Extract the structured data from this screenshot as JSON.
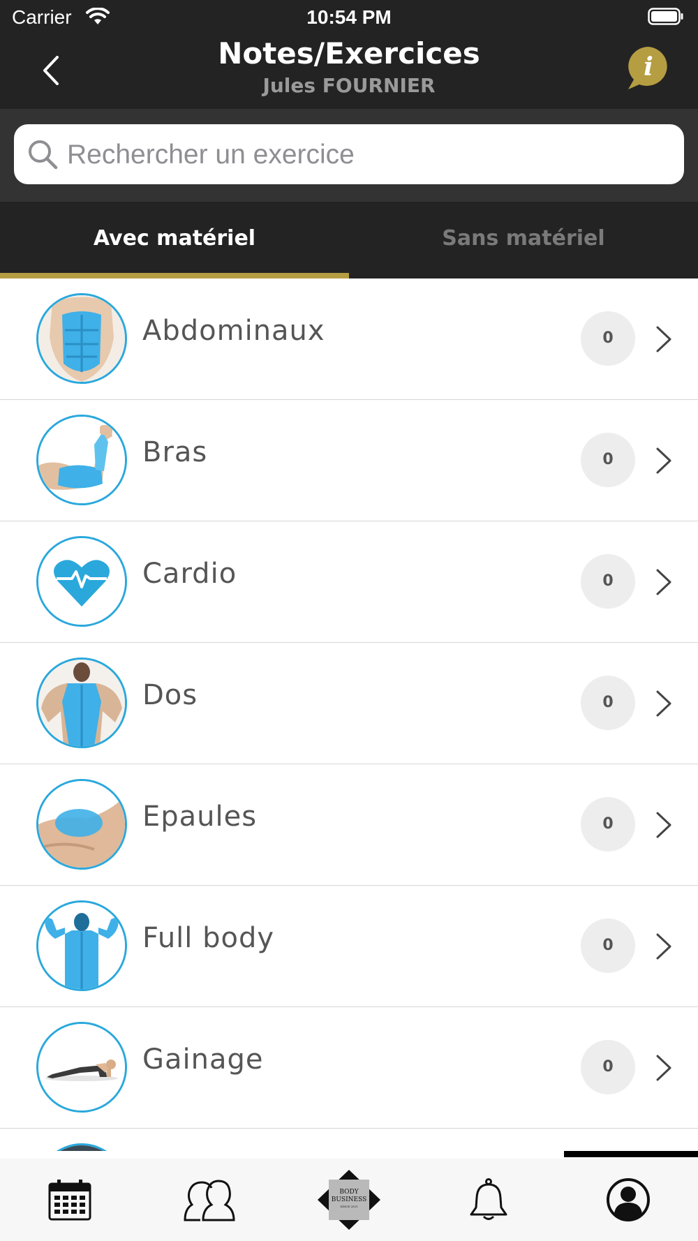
{
  "status_bar": {
    "carrier": "Carrier",
    "time": "10:54 PM"
  },
  "nav": {
    "title": "Notes/Exercices",
    "subtitle": "Jules FOURNIER",
    "info_letter": "i"
  },
  "search": {
    "placeholder": "Rechercher un exercice",
    "value": ""
  },
  "tabs": [
    {
      "label": "Avec matériel",
      "active": true
    },
    {
      "label": "Sans matériel",
      "active": false
    }
  ],
  "categories": [
    {
      "label": "Abdominaux",
      "count": "0",
      "icon": "abs-muscle-icon"
    },
    {
      "label": "Bras",
      "count": "0",
      "icon": "arm-muscle-icon"
    },
    {
      "label": "Cardio",
      "count": "0",
      "icon": "heart-pulse-icon"
    },
    {
      "label": "Dos",
      "count": "0",
      "icon": "back-muscle-icon"
    },
    {
      "label": "Epaules",
      "count": "0",
      "icon": "shoulder-muscle-icon"
    },
    {
      "label": "Full body",
      "count": "0",
      "icon": "full-body-icon"
    },
    {
      "label": "Gainage",
      "count": "0",
      "icon": "plank-icon"
    }
  ],
  "tabbar": {
    "logo_line1": "BODY",
    "logo_line2": "BUSINESS",
    "logo_line3": "SINCE 2021",
    "items": [
      "calendar-icon",
      "group-icon",
      "body-business-logo",
      "bell-icon",
      "profile-icon"
    ]
  },
  "colors": {
    "accent": "#b59d42",
    "avatar_ring": "#2aa8dc",
    "dark": "#232323",
    "info_button": "#b59d42"
  }
}
